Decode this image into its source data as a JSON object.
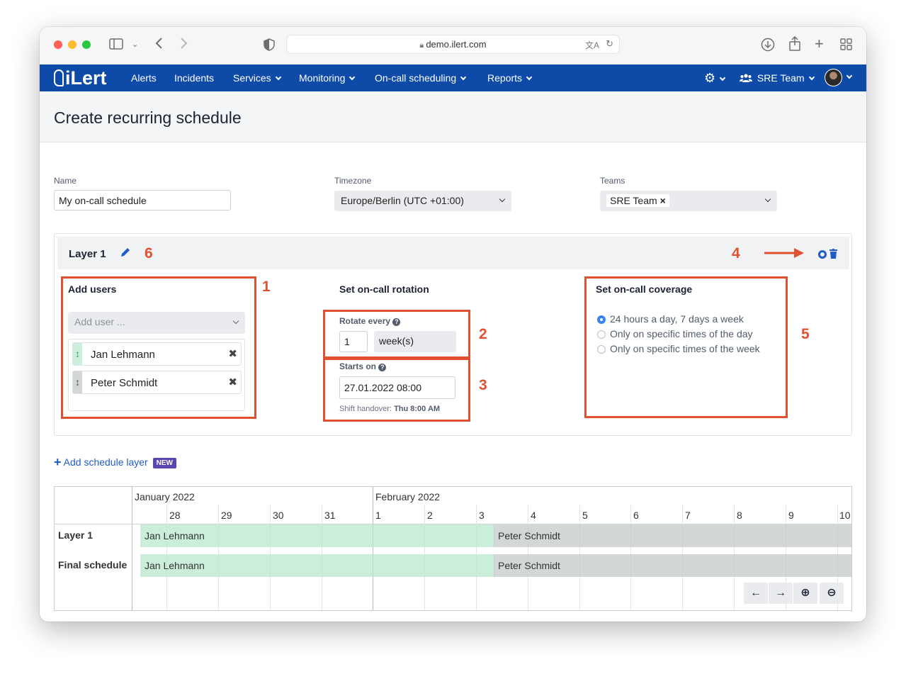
{
  "browser": {
    "url": "demo.ilert.com"
  },
  "nav": {
    "brand": "iLert",
    "items": [
      "Alerts",
      "Incidents",
      "Services",
      "Monitoring",
      "On-call scheduling",
      "Reports"
    ],
    "team": "SRE Team"
  },
  "page": {
    "title": "Create recurring schedule"
  },
  "form": {
    "name_label": "Name",
    "name_value": "My on-call schedule",
    "timezone_label": "Timezone",
    "timezone_value": "Europe/Berlin (UTC +01:00)",
    "teams_label": "Teams",
    "teams_value": "SRE Team",
    "teams_remove": "×"
  },
  "layer": {
    "title": "Layer 1",
    "add_users_title": "Add users",
    "add_user_placeholder": "Add user ...",
    "users": [
      {
        "name": "Jan Lehmann",
        "remove": "✖"
      },
      {
        "name": "Peter Schmidt",
        "remove": "✖"
      }
    ],
    "rotation_title": "Set on-call rotation",
    "rotate_every_label": "Rotate every",
    "rotate_every_value": "1",
    "rotate_every_unit": "week(s)",
    "starts_on_label": "Starts on",
    "starts_on_value": "27.01.2022 08:00",
    "handover_prefix": "Shift handover:",
    "handover_value": "Thu 8:00 AM",
    "coverage_title": "Set on-call coverage",
    "coverage_options": [
      {
        "label": "24 hours a day, 7 days a week",
        "selected": true
      },
      {
        "label": "Only on specific times of the day",
        "selected": false
      },
      {
        "label": "Only on specific times of the week",
        "selected": false
      }
    ]
  },
  "annotations": [
    "1",
    "2",
    "3",
    "4",
    "5",
    "6"
  ],
  "add_layer": {
    "label": "Add schedule layer",
    "badge": "NEW"
  },
  "timeline": {
    "months": [
      "January 2022",
      "February 2022"
    ],
    "days": [
      "28",
      "29",
      "30",
      "31",
      "1",
      "2",
      "3",
      "4",
      "5",
      "6",
      "7",
      "8",
      "9",
      "10"
    ],
    "rows": [
      {
        "label": "Layer 1",
        "shifts": [
          {
            "user": "Jan Lehmann"
          },
          {
            "user": "Peter Schmidt"
          }
        ]
      },
      {
        "label": "Final schedule",
        "shifts": [
          {
            "user": "Jan Lehmann"
          },
          {
            "user": "Peter Schmidt"
          }
        ]
      }
    ],
    "controls": [
      "←",
      "→",
      "⊕",
      "⊖"
    ]
  },
  "colors": {
    "nav": "#0e4ba8",
    "annotation": "#e2512f",
    "shift_jan": "#cdeedb",
    "shift_peter": "#d3d6d6",
    "badge": "#5b45b0"
  }
}
